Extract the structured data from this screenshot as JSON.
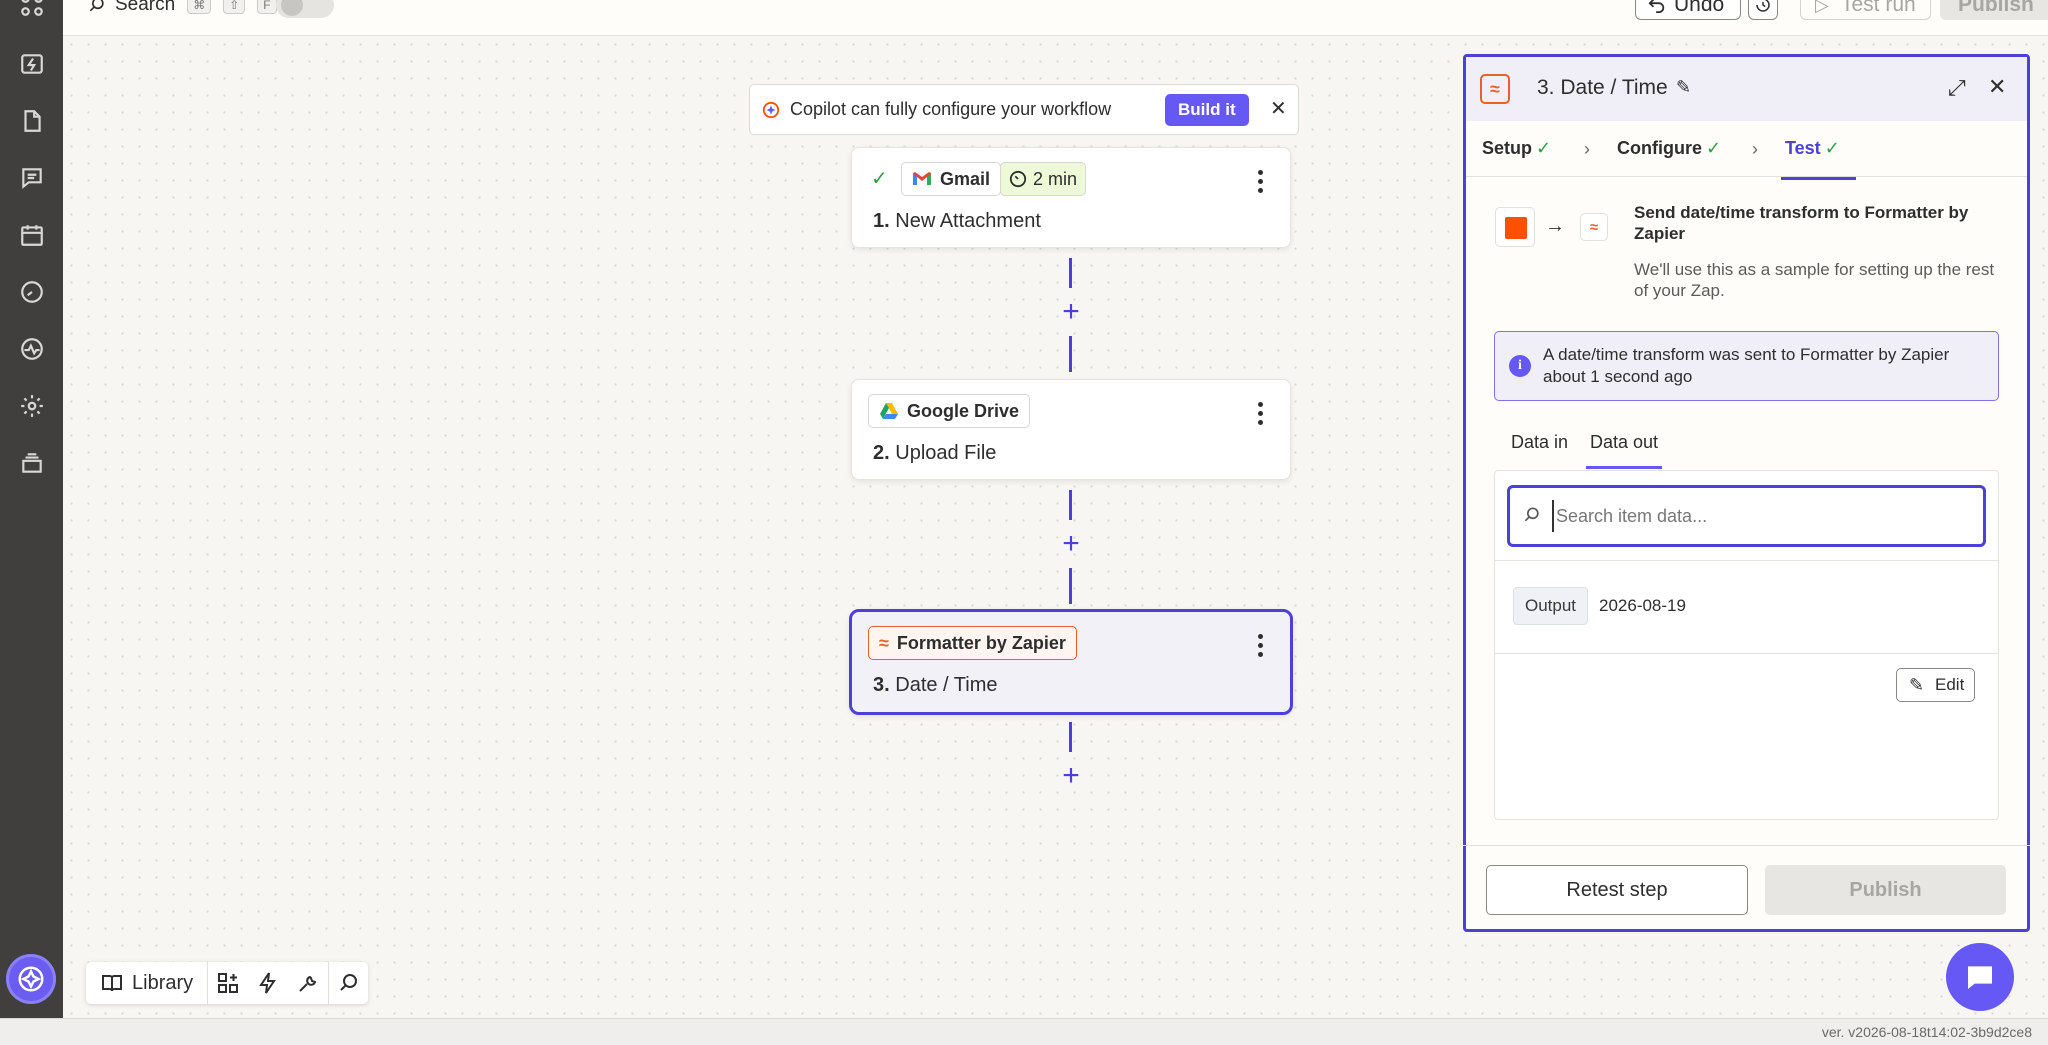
{
  "topbar": {
    "search_label": "Search",
    "shortcut_keys": [
      "⌘",
      "⇧",
      "F"
    ],
    "undo_label": "Undo",
    "test_run_label": "Test run",
    "publish_label": "Publish"
  },
  "copilot": {
    "text": "Copilot can fully configure your workflow",
    "build_label": "Build it"
  },
  "steps": [
    {
      "app": "Gmail",
      "number": "1.",
      "title": "New Attachment",
      "status": "complete",
      "time_badge": "2 min"
    },
    {
      "app": "Google Drive",
      "number": "2.",
      "title": "Upload File"
    },
    {
      "app": "Formatter by Zapier",
      "number": "3.",
      "title": "Date / Time",
      "selected": true
    }
  ],
  "bottom_toolbar": {
    "library_label": "Library"
  },
  "panel": {
    "title": "3. Date / Time",
    "tabs": [
      {
        "label": "Setup",
        "complete": true
      },
      {
        "label": "Configure",
        "complete": true
      },
      {
        "label": "Test",
        "complete": true,
        "active": true
      }
    ],
    "send_title": "Send date/time transform to Formatter by Zapier",
    "send_desc": "We'll use this as a sample for setting up the rest of your Zap.",
    "info_text": "A date/time transform was sent to Formatter by Zapier about 1 second ago",
    "data_tabs": [
      {
        "label": "Data in"
      },
      {
        "label": "Data out",
        "active": true
      }
    ],
    "search_placeholder": "Search item data...",
    "output_label": "Output",
    "output_value": "2026-08-19",
    "edit_label": "Edit",
    "retest_label": "Retest step",
    "publish_label": "Publish"
  },
  "version": "ver. v2026-08-18t14:02-3b9d2ce8",
  "colors": {
    "accent": "#4c40d8",
    "button_primary": "#6558f5",
    "success": "#2f9e44",
    "formatter_orange": "#e8612c",
    "zapier_orange": "#ff4f00",
    "rail_bg": "#403f3e"
  }
}
